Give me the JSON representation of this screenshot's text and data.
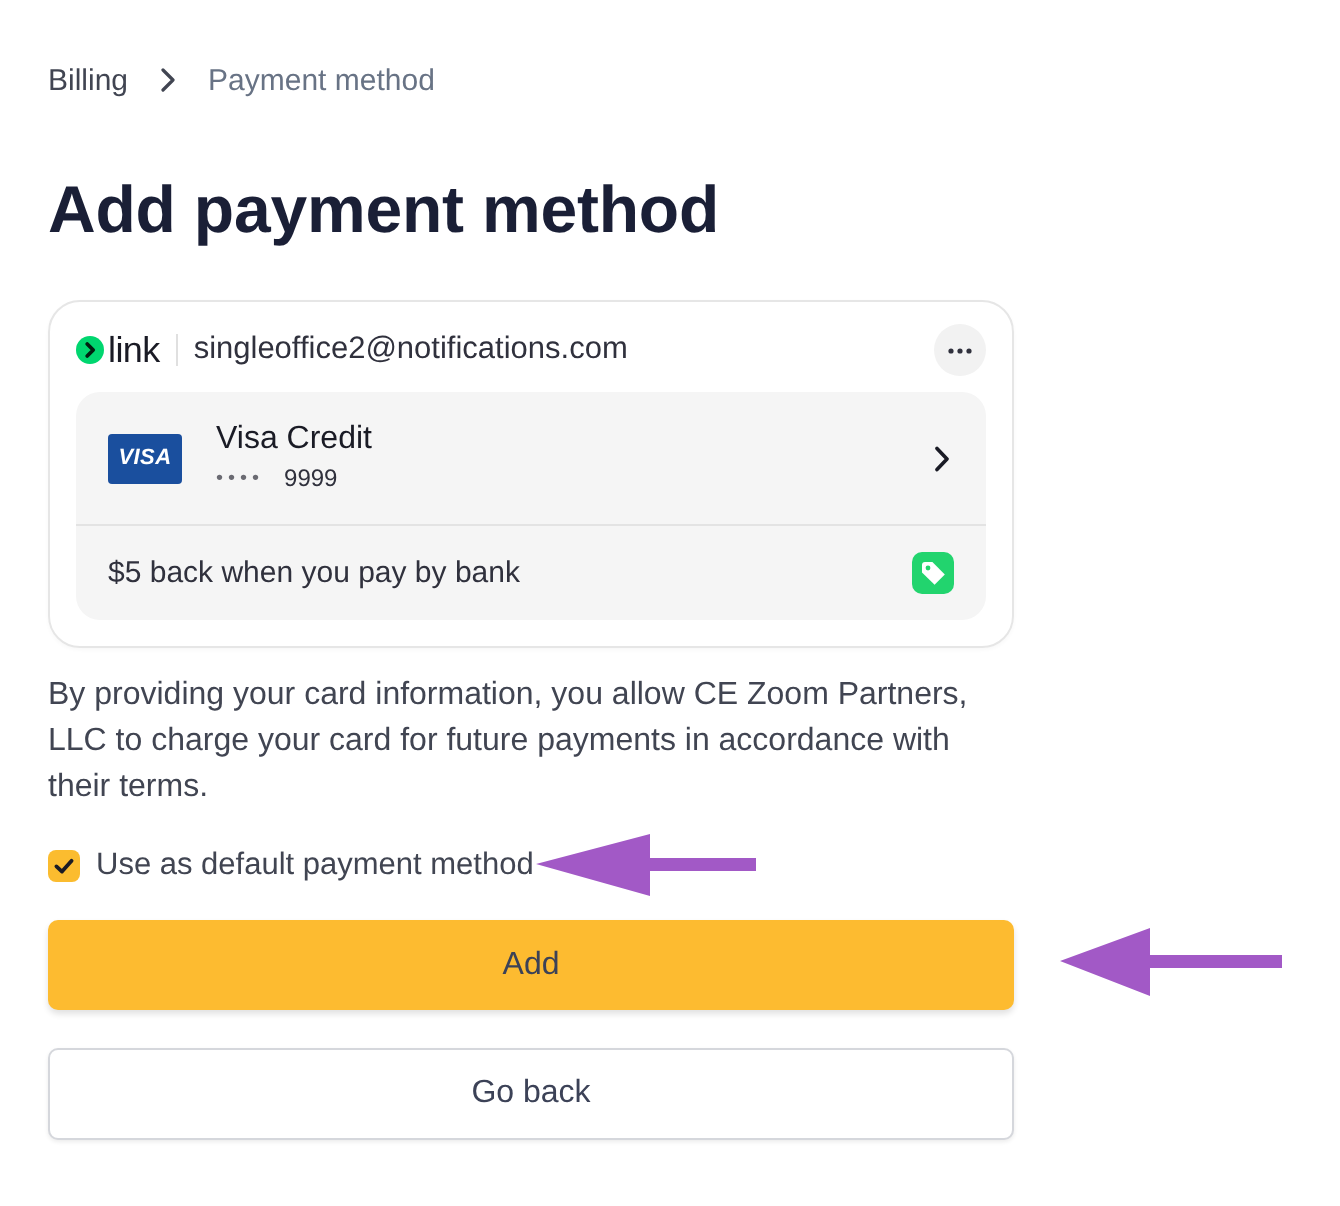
{
  "breadcrumb": [
    {
      "label": "Billing",
      "current": false
    },
    {
      "label": "Payment method",
      "current": true
    }
  ],
  "title": "Add payment method",
  "link_card": {
    "logo": "link",
    "email": "singleoffice2@notifications.com",
    "card": {
      "brand": "VISA",
      "name": "Visa Credit",
      "masked": "••••",
      "last4": "9999"
    },
    "promo": "$5 back when you pay by bank"
  },
  "consent": "By providing your card information, you allow CE Zoom Partners, LLC to charge your card for future payments in accordance with their terms.",
  "default_checkbox": {
    "label": "Use as default payment method",
    "checked": true
  },
  "buttons": [
    {
      "label": "Add",
      "kind": "primary"
    },
    {
      "label": "Go back",
      "kind": "secondary"
    }
  ]
}
